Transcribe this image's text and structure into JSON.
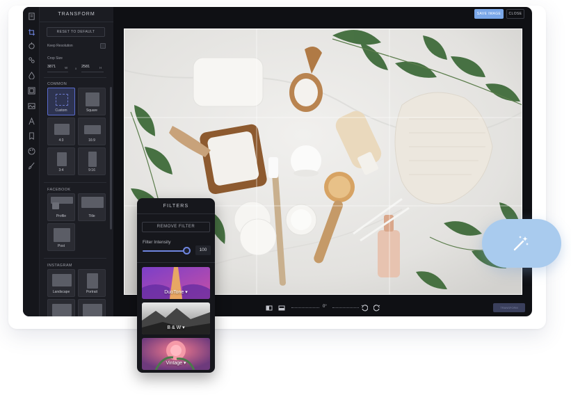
{
  "app": {
    "panel_title": "TRANSFORM",
    "save_label": "SAVE IMAGE",
    "close_label": "CLOSE",
    "done_label": "TRANSFORM"
  },
  "rail": {
    "icons": [
      "document-icon",
      "crop-icon",
      "adjust-icon",
      "effects-icon",
      "drop-icon",
      "frame-icon",
      "overlay-icon",
      "text-icon",
      "bookmark-icon",
      "palette-icon",
      "brush-icon"
    ]
  },
  "transform": {
    "reset_label": "RESET TO DEFAULT",
    "keep_resolution_label": "Keep Resolution",
    "crop_size_label": "Crop Size",
    "width_value": "3871",
    "width_unit": "W",
    "separator": "x",
    "height_value": "2581",
    "height_unit": "H",
    "sections": [
      {
        "title": "COMMON",
        "items": [
          {
            "label": "Custom",
            "active": true
          },
          {
            "label": "Square",
            "active": false
          },
          {
            "label": "4:3",
            "active": false
          },
          {
            "label": "16:9",
            "active": false
          },
          {
            "label": "3:4",
            "active": false
          },
          {
            "label": "9:16",
            "active": false
          }
        ]
      },
      {
        "title": "FACEBOOK",
        "items": [
          {
            "label": "Profile",
            "active": false
          },
          {
            "label": "Title",
            "active": false
          },
          {
            "label": "Post",
            "active": false
          }
        ]
      },
      {
        "title": "INSTAGRAM",
        "items": [
          {
            "label": "Landscape",
            "active": false
          },
          {
            "label": "Portrait",
            "active": false
          }
        ]
      }
    ]
  },
  "toolbar": {
    "angle": "0°"
  },
  "filters": {
    "title": "FILTERS",
    "remove_label": "REMOVE FILTER",
    "intensity_label": "Filter Intensity",
    "intensity_value": "100",
    "intensity_fraction": 1.0,
    "items": [
      {
        "label": "DuoTone",
        "colors": [
          "#8a4fd1",
          "#e2a24a"
        ]
      },
      {
        "label": "B & W",
        "colors": [
          "#333333",
          "#d8d8d8"
        ]
      },
      {
        "label": "Vintage",
        "colors": [
          "#a34a9b",
          "#f0708a"
        ]
      }
    ]
  },
  "colors": {
    "accent": "#7aa7e8",
    "slider": "#6f86e0",
    "magic_bubble": "#a9cbee"
  }
}
